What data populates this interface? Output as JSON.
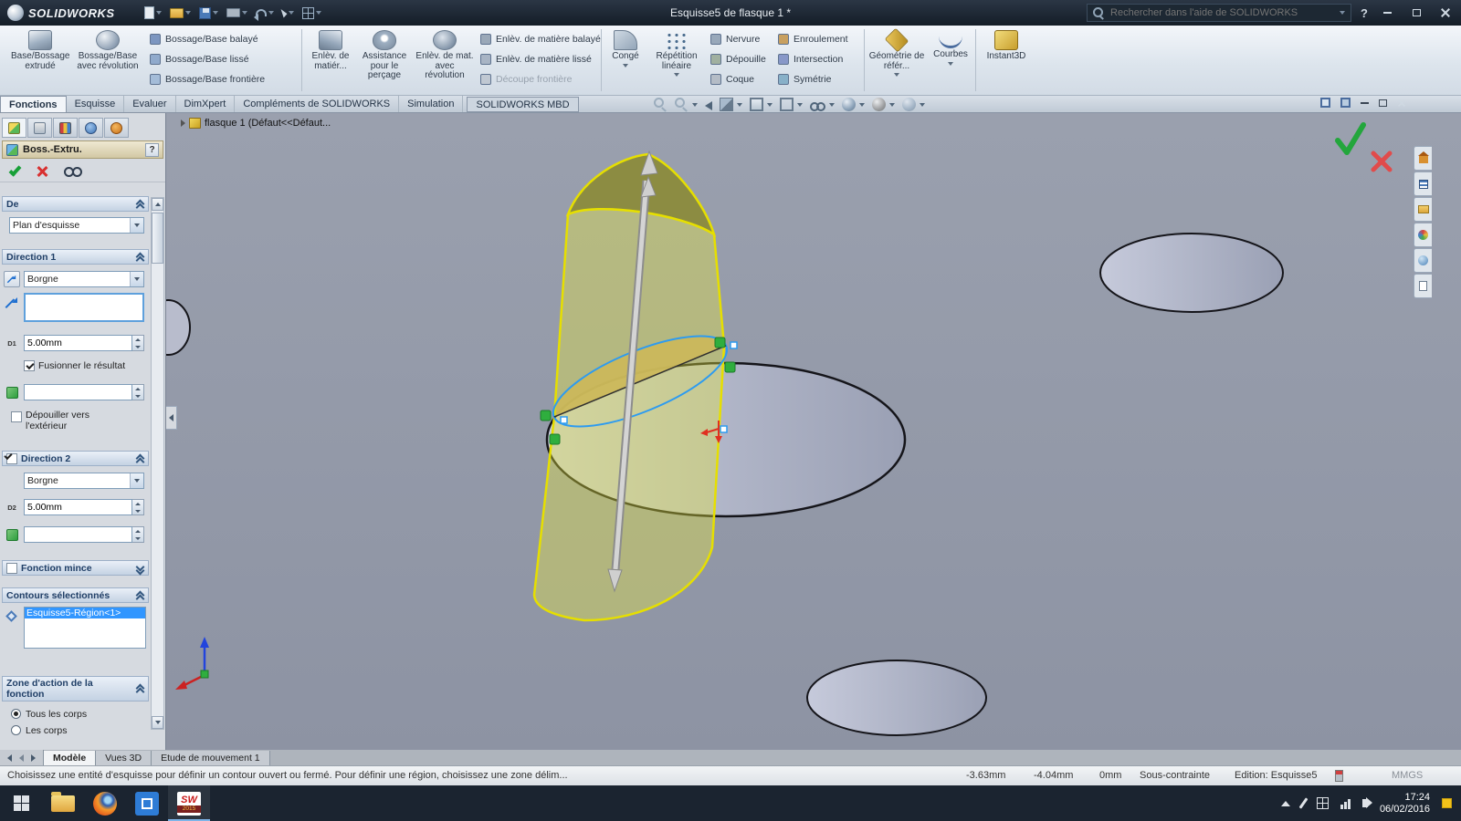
{
  "colors": {
    "accent_yellow": "#e6df00",
    "selection_blue": "#3196ff",
    "viewport_gray": "#9298a6",
    "titlebar_dark": "#1b2430"
  },
  "icons": {
    "search": "magnifier",
    "help": "question-mark",
    "ok": "green-check",
    "cancel": "red-x",
    "preview": "eyeglasses",
    "section_chevron": "double-chevron"
  },
  "titlebar": {
    "brand": "SOLIDWORKS",
    "title": "Esquisse5 de flasque 1 *",
    "search_placeholder": "Rechercher dans l'aide de SOLIDWORKS",
    "help": "?"
  },
  "ribbon": {
    "extrude": "Base/Bossage extrudé",
    "revolve": "Bossage/Base avec révolution",
    "swept_boss": "Bossage/Base balayé",
    "lofted_boss": "Bossage/Base lissé",
    "boundary_boss": "Bossage/Base frontière",
    "cut_extrude": "Enlèv. de matiér...",
    "hole_wizard": "Assistance pour le perçage",
    "cut_revolve": "Enlèv. de mat. avec révolution",
    "swept_cut": "Enlèv. de matière balayé",
    "lofted_cut": "Enlèv. de matière lissé",
    "boundary_cut": "Découpe frontière",
    "fillet": "Congé",
    "pattern": "Répétition linéaire",
    "rib": "Nervure",
    "draft": "Dépouille",
    "shell": "Coque",
    "wrap": "Enroulement",
    "intersect": "Intersection",
    "mirror": "Symétrie",
    "ref_geometry": "Géométrie de référ...",
    "curves": "Courbes",
    "instant3d": "Instant3D"
  },
  "tabs": [
    "Fonctions",
    "Esquisse",
    "Evaluer",
    "DimXpert",
    "Compléments de SOLIDWORKS",
    "Simulation",
    "SOLIDWORKS MBD"
  ],
  "property_manager": {
    "title": "Boss.-Extru.",
    "help": "?",
    "from": {
      "header": "De",
      "value": "Plan d'esquisse"
    },
    "direction1": {
      "header": "Direction 1",
      "end_condition": "Borgne",
      "depth": "5.00mm",
      "d_label": "D1",
      "merge_result": "Fusionner le résultat",
      "draft_outward": "Dépouiller vers l'extérieur"
    },
    "direction2": {
      "header": "Direction 2",
      "end_condition": "Borgne",
      "depth": "5.00mm",
      "d_label": "D2"
    },
    "thin_feature": {
      "header": "Fonction mince"
    },
    "selected_contours": {
      "header": "Contours sélectionnés",
      "item": "Esquisse5-Région<1>"
    },
    "feature_scope": {
      "header": "Zone d'action de la fonction",
      "option1": "Tous les corps",
      "option2": "Les corps"
    }
  },
  "feature_tree": {
    "root": "flasque 1  (Défaut<<Défaut..."
  },
  "model_tabs": {
    "model": "Modèle",
    "views3d": "Vues 3D",
    "motion": "Etude de mouvement 1"
  },
  "statusbar": {
    "message": "Choisissez une entité d'esquisse pour définir un contour ouvert ou fermé. Pour définir une région, choisissez une zone délim...",
    "coord_x": "-3.63mm",
    "coord_y": "-4.04mm",
    "coord_z": "0mm",
    "state": "Sous-contrainte",
    "editing": "Edition: Esquisse5",
    "units": "MMGS"
  },
  "taskbar": {
    "time": "17:24",
    "date": "06/02/2016",
    "sw_logo": "SW",
    "sw_year": "2015"
  }
}
